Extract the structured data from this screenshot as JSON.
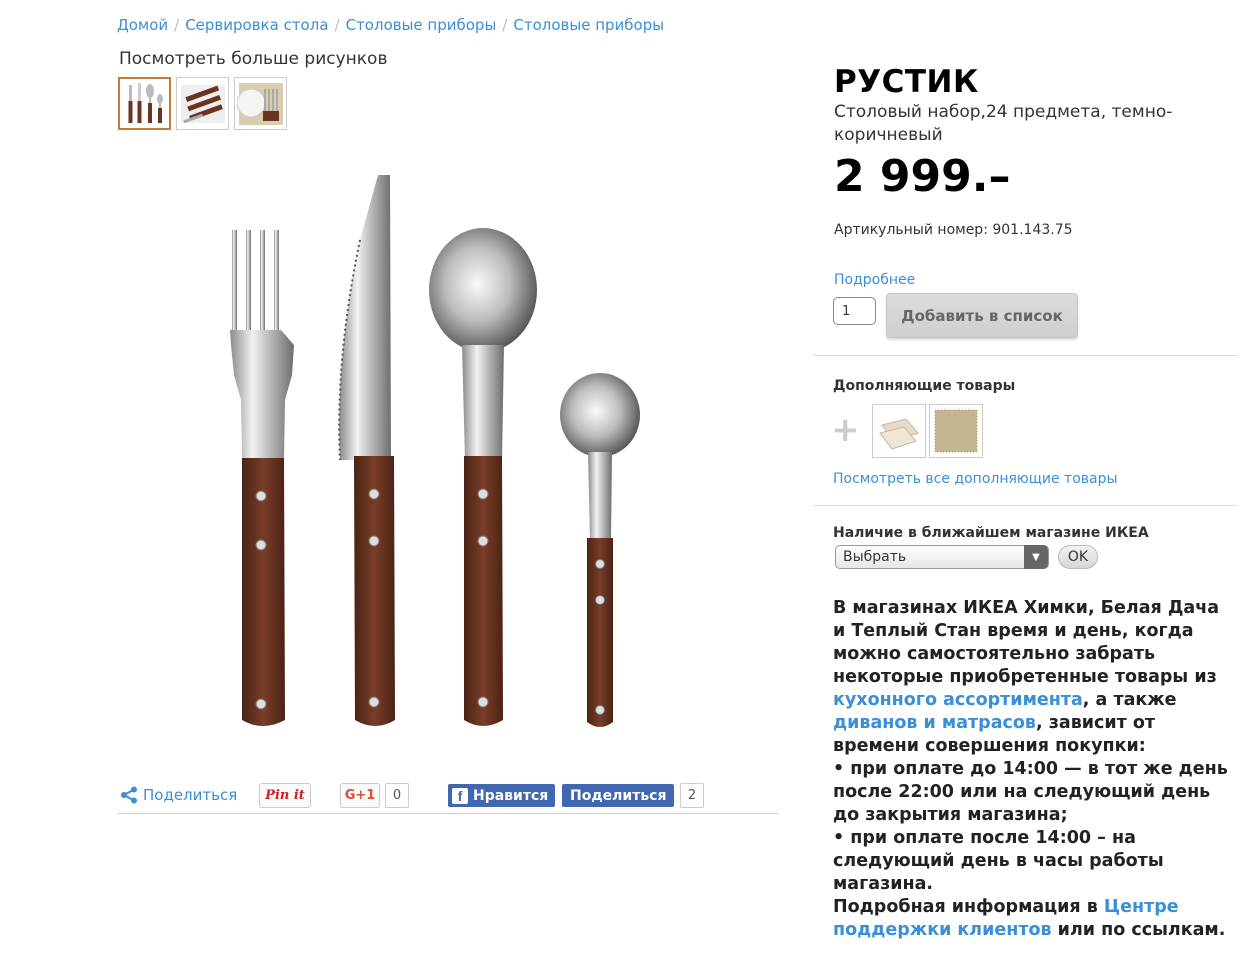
{
  "breadcrumb": [
    "Домой",
    "Сервировка стола",
    "Столовые приборы",
    "Столовые приборы"
  ],
  "gallery": {
    "more_label": "Посмотреть больше рисунков",
    "thumbs": [
      "cutlery-set-thumb",
      "cutlery-box-thumb",
      "table-setting-thumb"
    ]
  },
  "share": {
    "share_label": "Поделиться",
    "pin_label": "Pin it",
    "gplus_label": "G+1",
    "gplus_count": "0",
    "fb_like_label": "Нравится",
    "fb_share_label": "Поделиться",
    "fb_count": "2"
  },
  "product": {
    "name": "РУСТИК",
    "description": "Столовый набор,24 предмета, темно-коричневый",
    "price": "2 999.–",
    "article": "Артикульный номер: 901.143.75",
    "details_link": "Подробнее",
    "quantity": "1",
    "add_button": "Добавить в список"
  },
  "complementary": {
    "title": "Дополняющие товары",
    "see_all": "Посмотреть все дополняющие товары"
  },
  "availability": {
    "title": "Наличие в ближайшем магазине ИКЕА",
    "select_value": "Выбрать",
    "ok": "OK"
  },
  "info": {
    "p1_a": "В магазинах ИКЕА Химки, Белая Дача и Теплый Стан время и день, когда можно самостоятельно забрать некоторые приобретенные товары из ",
    "link1": "кухонного ассортимента",
    "p1_b": ", а также ",
    "link2": "диванов и матрасов",
    "p1_c": ", зависит от времени совершения покупки:",
    "bullet1": "• при оплате до 14:00 — в тот же день после 22:00 или на следующий день до закрытия магазина;",
    "bullet2": "• при оплате после 14:00 – на следующий день в часы работы магазина.",
    "p2_a": "Подробная информация в ",
    "link3": "Центре поддержки клиентов",
    "p2_b": " или по ссылкам."
  },
  "colors": {
    "link": "#3a8fd6",
    "handle": "#6b3322",
    "fb": "#4267b2",
    "active_thumb_border": "#c77b3b"
  }
}
